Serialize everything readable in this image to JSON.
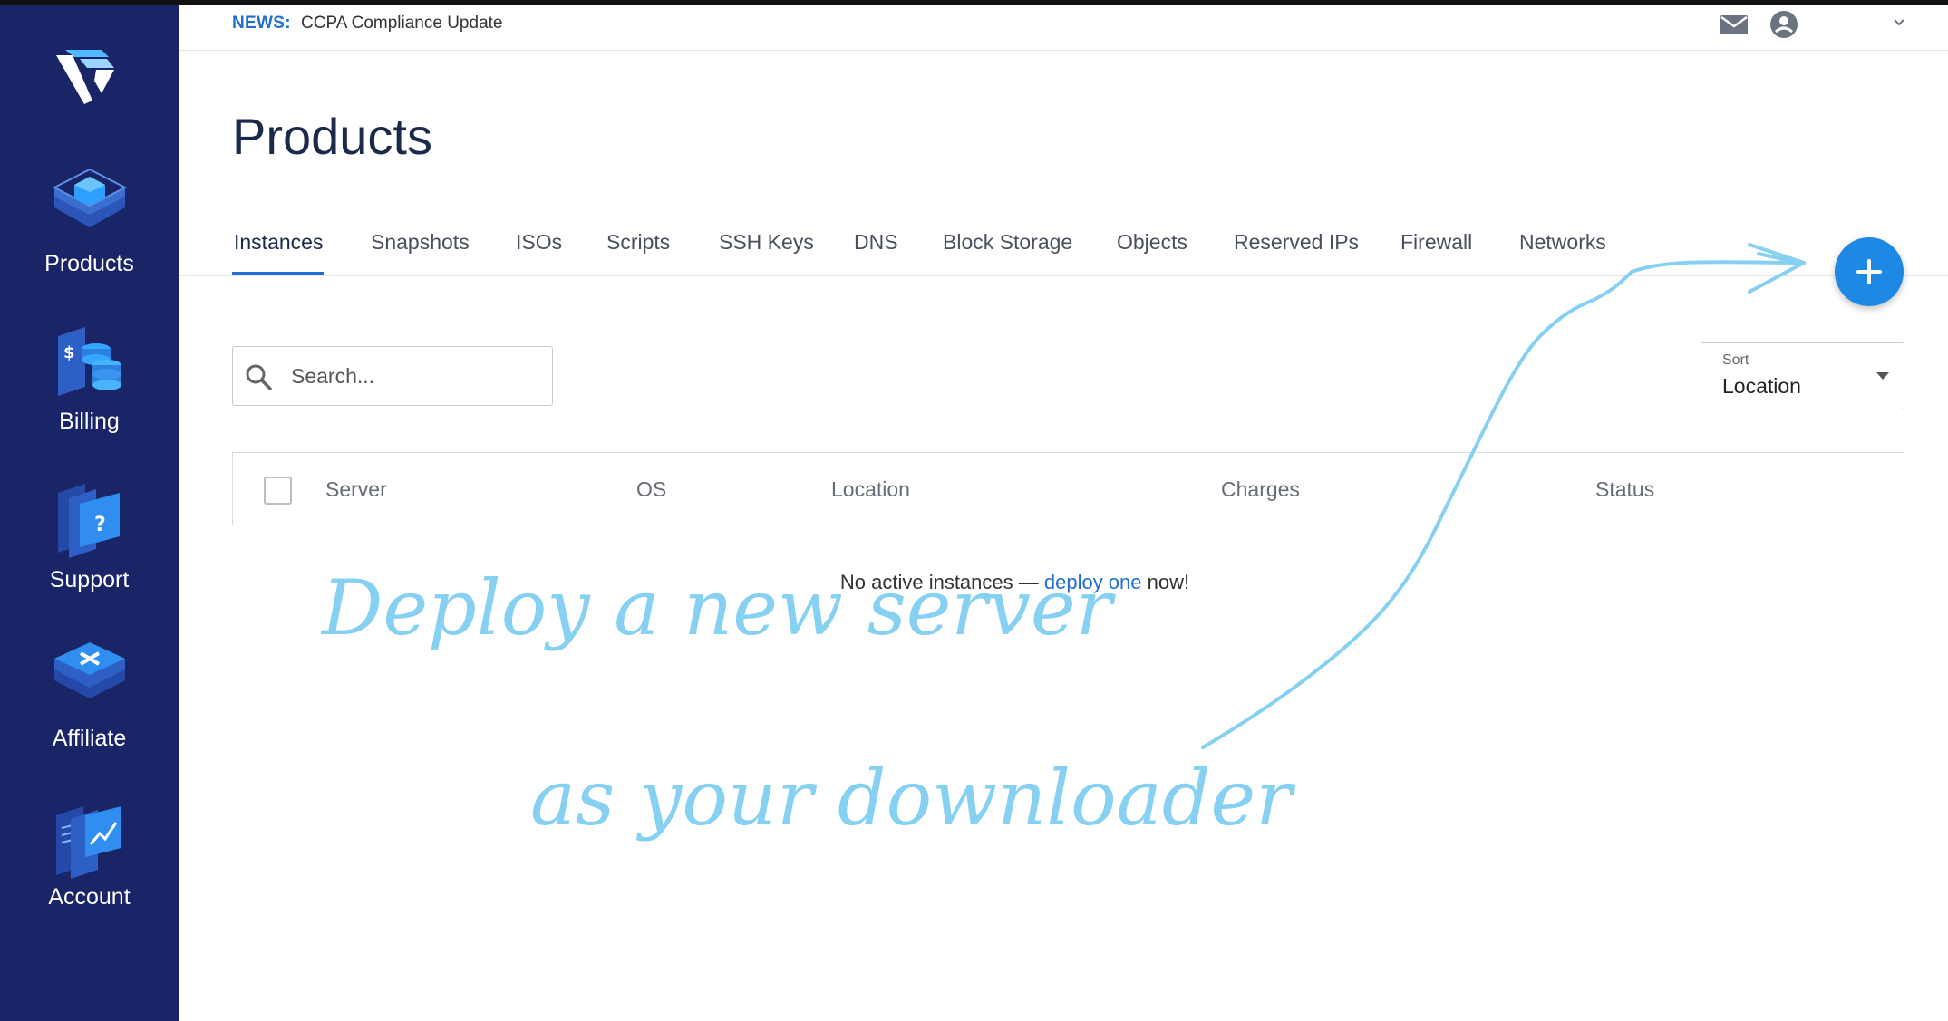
{
  "news": {
    "label": "NEWS:",
    "text": "CCPA Compliance Update"
  },
  "sidebar": {
    "items": [
      {
        "label": "Products",
        "icon": "products-icon"
      },
      {
        "label": "Billing",
        "icon": "billing-icon"
      },
      {
        "label": "Support",
        "icon": "support-icon"
      },
      {
        "label": "Affiliate",
        "icon": "affiliate-icon"
      },
      {
        "label": "Account",
        "icon": "account-icon"
      }
    ]
  },
  "page": {
    "title": "Products"
  },
  "tabs": [
    {
      "label": "Instances",
      "active": true
    },
    {
      "label": "Snapshots"
    },
    {
      "label": "ISOs"
    },
    {
      "label": "Scripts"
    },
    {
      "label": "SSH Keys"
    },
    {
      "label": "DNS"
    },
    {
      "label": "Block Storage"
    },
    {
      "label": "Objects"
    },
    {
      "label": "Reserved IPs"
    },
    {
      "label": "Firewall"
    },
    {
      "label": "Networks"
    }
  ],
  "search": {
    "placeholder": "Search..."
  },
  "sort": {
    "label": "Sort",
    "value": "Location"
  },
  "table": {
    "columns": [
      "Server",
      "OS",
      "Location",
      "Charges",
      "Status"
    ]
  },
  "empty_state": {
    "prefix": "No active instances — ",
    "link": "deploy one",
    "suffix": " now!"
  },
  "annotation": {
    "line1": "Deploy a new server",
    "line2": "as your downloader"
  },
  "colors": {
    "sidebar": "#1a2567",
    "accent": "#1f6fd1",
    "fab": "#1e88e5",
    "handwriting": "#86d0f1"
  }
}
